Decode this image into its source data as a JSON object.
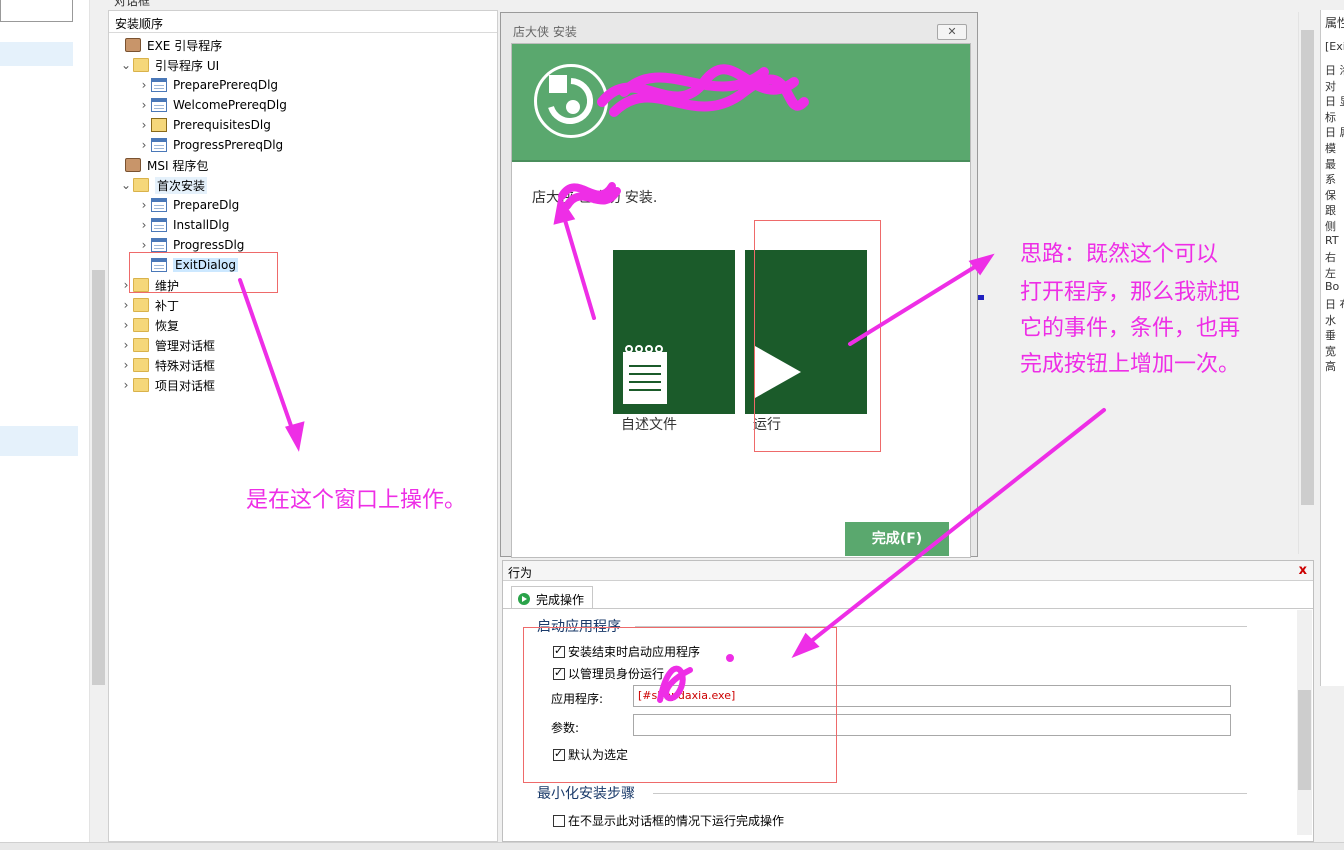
{
  "top_title": "对话框",
  "tree": {
    "header": "安装顺序",
    "items": [
      {
        "label": "EXE 引导程序",
        "arrow": "",
        "icon": "pkg",
        "indent": 0
      },
      {
        "label": "引导程序 UI",
        "arrow": "⌄",
        "icon": "folder",
        "indent": 1
      },
      {
        "label": "PreparePrereqDlg",
        "arrow": "›",
        "icon": "dialog",
        "indent": 2
      },
      {
        "label": "WelcomePrereqDlg",
        "arrow": "›",
        "icon": "dialog",
        "indent": 2
      },
      {
        "label": "PrerequisitesDlg",
        "arrow": "›",
        "icon": "prereq",
        "indent": 2
      },
      {
        "label": "ProgressPrereqDlg",
        "arrow": "›",
        "icon": "dialog",
        "indent": 2
      },
      {
        "label": "MSI 程序包",
        "arrow": "",
        "icon": "pkg",
        "indent": 0
      },
      {
        "label": "首次安装",
        "arrow": "⌄",
        "icon": "folder",
        "indent": 1
      },
      {
        "label": "PrepareDlg",
        "arrow": "›",
        "icon": "dialog",
        "indent": 2
      },
      {
        "label": "InstallDlg",
        "arrow": "›",
        "icon": "dialog",
        "indent": 2
      },
      {
        "label": "ProgressDlg",
        "arrow": "›",
        "icon": "dialog",
        "indent": 2
      },
      {
        "label": "ExitDialog",
        "arrow": "",
        "icon": "dialog",
        "indent": 2
      },
      {
        "label": "维护",
        "arrow": "›",
        "icon": "folder",
        "indent": 1
      },
      {
        "label": "补丁",
        "arrow": "›",
        "icon": "folder",
        "indent": 1
      },
      {
        "label": "恢复",
        "arrow": "›",
        "icon": "folder",
        "indent": 1
      },
      {
        "label": "管理对话框",
        "arrow": "›",
        "icon": "folder",
        "indent": 1
      },
      {
        "label": "特殊对话框",
        "arrow": "›",
        "icon": "folder",
        "indent": 1
      },
      {
        "label": "项目对话框",
        "arrow": "›",
        "icon": "folder",
        "indent": 1
      }
    ]
  },
  "dialog": {
    "title": "店大侠 安装",
    "close": "✕",
    "message": "店大侠 已成功 安装.",
    "tile_readme_label": "自述文件",
    "tile_run_label": "运行",
    "finish_button": "完成(F)"
  },
  "properties": {
    "header": "属性",
    "selector": "[Exit",
    "rows": [
      "日 洛",
      "对",
      "日 显",
      "标",
      "日 属",
      "模",
      "最",
      "系",
      "保",
      "跟",
      "侧",
      "RT",
      "右",
      "左",
      "Bo",
      "日 布",
      "水",
      "垂",
      "宽",
      "高"
    ]
  },
  "behavior": {
    "title": "行为",
    "close": "x",
    "tab_label": "完成操作",
    "section1_title": "启动应用程序",
    "chk_launch_at_end": "安装结束时启动应用程序",
    "chk_run_as_admin": "以管理员身份运行",
    "app_label": "应用程序:",
    "app_value": "[#shopdaxia.exe]",
    "params_label": "参数:",
    "params_value": "",
    "chk_default_selected": "默认为选定",
    "section2_title": "最小化安装步骤",
    "chk_no_dialog": "在不显示此对话框的情况下运行完成操作"
  },
  "annotations": {
    "window_note": "是在这个窗口上操作。",
    "idea_note_lines": [
      "思路：既然这个可以",
      "打开程序，那么我就把",
      "它的事件，条件，也再",
      "完成按钮上增加一次。"
    ]
  },
  "colors": {
    "annotation": "#ee2ee6",
    "banner_green": "#5aa86e",
    "tile_green": "#1b5b2a",
    "highlight_box": "#ee6a6a"
  }
}
